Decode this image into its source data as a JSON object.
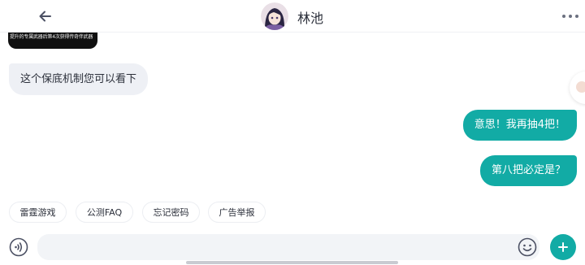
{
  "header": {
    "back_icon": "arrow-left-icon",
    "title": "林池",
    "more_icon": "more-horizontal-icon"
  },
  "messages": [
    {
      "side": "in",
      "type": "image",
      "caption": "提升的专属武器后第4次获得传奇伴武器"
    },
    {
      "side": "in",
      "type": "text",
      "text": "这个保底机制您可以看下"
    },
    {
      "side": "out",
      "type": "text",
      "text": "意思！我再抽4把！"
    },
    {
      "side": "out",
      "type": "text",
      "text": "第八把必定是？"
    }
  ],
  "quick_replies": [
    "雷霆游戏",
    "公测FAQ",
    "忘记密码",
    "广告举报"
  ],
  "input_bar": {
    "voice_icon": "voice-icon",
    "placeholder": "",
    "emoji_icon": "emoji-icon",
    "add_icon": "plus-icon"
  },
  "colors": {
    "accent": "#12aba5",
    "incoming_bubble": "#eef0f5",
    "input_bg": "#f2f4f7"
  }
}
